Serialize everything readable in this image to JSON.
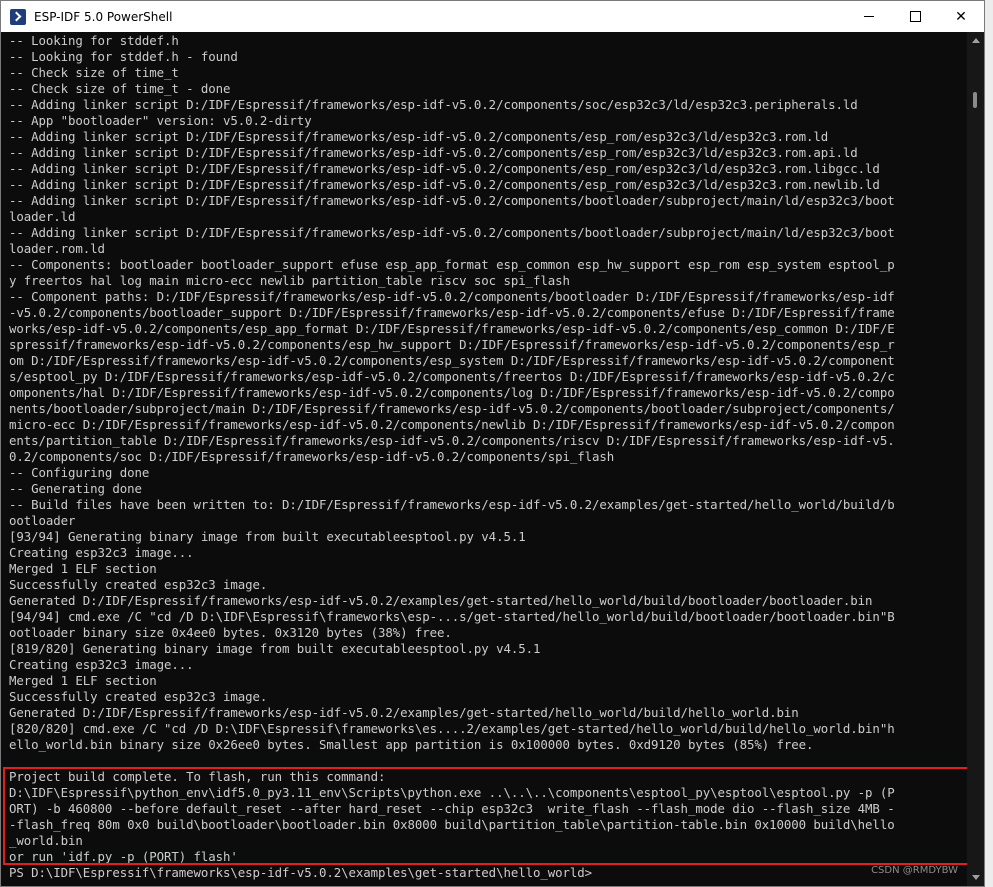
{
  "window": {
    "title": "ESP-IDF 5.0 PowerShell",
    "minimize_label": "minimize",
    "maximize_label": "maximize",
    "close_label": "✕"
  },
  "terminal": {
    "lines": [
      "-- Looking for stddef.h",
      "-- Looking for stddef.h - found",
      "-- Check size of time_t",
      "-- Check size of time_t - done",
      "-- Adding linker script D:/IDF/Espressif/frameworks/esp-idf-v5.0.2/components/soc/esp32c3/ld/esp32c3.peripherals.ld",
      "-- App \"bootloader\" version: v5.0.2-dirty",
      "-- Adding linker script D:/IDF/Espressif/frameworks/esp-idf-v5.0.2/components/esp_rom/esp32c3/ld/esp32c3.rom.ld",
      "-- Adding linker script D:/IDF/Espressif/frameworks/esp-idf-v5.0.2/components/esp_rom/esp32c3/ld/esp32c3.rom.api.ld",
      "-- Adding linker script D:/IDF/Espressif/frameworks/esp-idf-v5.0.2/components/esp_rom/esp32c3/ld/esp32c3.rom.libgcc.ld",
      "-- Adding linker script D:/IDF/Espressif/frameworks/esp-idf-v5.0.2/components/esp_rom/esp32c3/ld/esp32c3.rom.newlib.ld",
      "-- Adding linker script D:/IDF/Espressif/frameworks/esp-idf-v5.0.2/components/bootloader/subproject/main/ld/esp32c3/boot",
      "loader.ld",
      "-- Adding linker script D:/IDF/Espressif/frameworks/esp-idf-v5.0.2/components/bootloader/subproject/main/ld/esp32c3/boot",
      "loader.rom.ld",
      "-- Components: bootloader bootloader_support efuse esp_app_format esp_common esp_hw_support esp_rom esp_system esptool_p",
      "y freertos hal log main micro-ecc newlib partition_table riscv soc spi_flash",
      "-- Component paths: D:/IDF/Espressif/frameworks/esp-idf-v5.0.2/components/bootloader D:/IDF/Espressif/frameworks/esp-idf",
      "-v5.0.2/components/bootloader_support D:/IDF/Espressif/frameworks/esp-idf-v5.0.2/components/efuse D:/IDF/Espressif/frame",
      "works/esp-idf-v5.0.2/components/esp_app_format D:/IDF/Espressif/frameworks/esp-idf-v5.0.2/components/esp_common D:/IDF/E",
      "spressif/frameworks/esp-idf-v5.0.2/components/esp_hw_support D:/IDF/Espressif/frameworks/esp-idf-v5.0.2/components/esp_r",
      "om D:/IDF/Espressif/frameworks/esp-idf-v5.0.2/components/esp_system D:/IDF/Espressif/frameworks/esp-idf-v5.0.2/component",
      "s/esptool_py D:/IDF/Espressif/frameworks/esp-idf-v5.0.2/components/freertos D:/IDF/Espressif/frameworks/esp-idf-v5.0.2/c",
      "omponents/hal D:/IDF/Espressif/frameworks/esp-idf-v5.0.2/components/log D:/IDF/Espressif/frameworks/esp-idf-v5.0.2/compo",
      "nents/bootloader/subproject/main D:/IDF/Espressif/frameworks/esp-idf-v5.0.2/components/bootloader/subproject/components/",
      "micro-ecc D:/IDF/Espressif/frameworks/esp-idf-v5.0.2/components/newlib D:/IDF/Espressif/frameworks/esp-idf-v5.0.2/compon",
      "ents/partition_table D:/IDF/Espressif/frameworks/esp-idf-v5.0.2/components/riscv D:/IDF/Espressif/frameworks/esp-idf-v5.",
      "0.2/components/soc D:/IDF/Espressif/frameworks/esp-idf-v5.0.2/components/spi_flash",
      "-- Configuring done",
      "-- Generating done",
      "-- Build files have been written to: D:/IDF/Espressif/frameworks/esp-idf-v5.0.2/examples/get-started/hello_world/build/b",
      "ootloader",
      "[93/94] Generating binary image from built executableesptool.py v4.5.1",
      "Creating esp32c3 image...",
      "Merged 1 ELF section",
      "Successfully created esp32c3 image.",
      "Generated D:/IDF/Espressif/frameworks/esp-idf-v5.0.2/examples/get-started/hello_world/build/bootloader/bootloader.bin",
      "[94/94] cmd.exe /C \"cd /D D:\\IDF\\Espressif\\frameworks\\esp-...s/get-started/hello_world/build/bootloader/bootloader.bin\"B",
      "ootloader binary size 0x4ee0 bytes. 0x3120 bytes (38%) free.",
      "[819/820] Generating binary image from built executableesptool.py v4.5.1",
      "Creating esp32c3 image...",
      "Merged 1 ELF section",
      "Successfully created esp32c3 image.",
      "Generated D:/IDF/Espressif/frameworks/esp-idf-v5.0.2/examples/get-started/hello_world/build/hello_world.bin",
      "[820/820] cmd.exe /C \"cd /D D:\\IDF\\Espressif\\frameworks\\es....2/examples/get-started/hello_world/build/hello_world.bin\"h",
      "ello_world.bin binary size 0x26ee0 bytes. Smallest app partition is 0x100000 bytes. 0xd9120 bytes (85%) free.",
      "",
      "Project build complete. To flash, run this command:",
      "D:\\IDF\\Espressif\\python_env\\idf5.0_py3.11_env\\Scripts\\python.exe ..\\..\\..\\components\\esptool_py\\esptool\\esptool.py -p (P",
      "ORT) -b 460800 --before default_reset --after hard_reset --chip esp32c3  write_flash --flash_mode dio --flash_size 4MB -",
      "-flash_freq 80m 0x0 build\\bootloader\\bootloader.bin 0x8000 build\\partition_table\\partition-table.bin 0x10000 build\\hello",
      "_world.bin",
      "or run 'idf.py -p (PORT) flash'",
      "PS D:\\IDF\\Espressif\\frameworks\\esp-idf-v5.0.2\\examples\\get-started\\hello_world>"
    ]
  },
  "watermark": "CSDN @RMDYBW",
  "colors": {
    "terminal_bg": "#0c0c0c",
    "terminal_fg": "#cccccc",
    "highlight_border": "#e02020"
  }
}
